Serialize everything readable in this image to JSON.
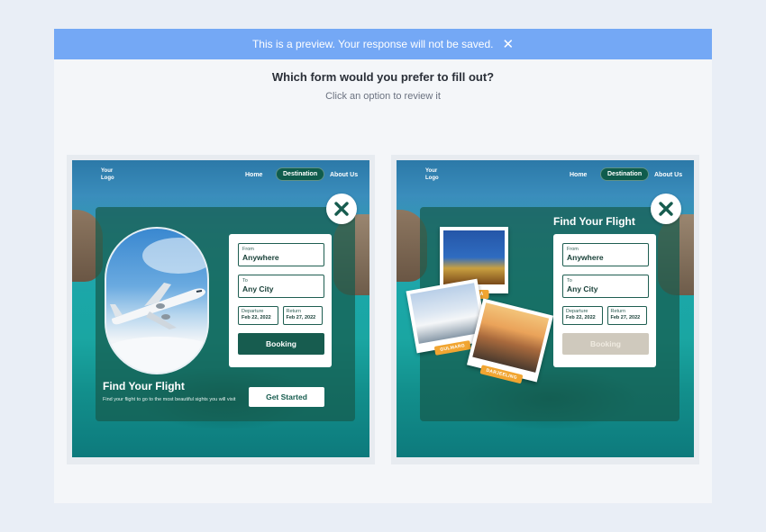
{
  "banner": {
    "text": "This is a preview. Your response will not be saved.",
    "close": "✕"
  },
  "question": "Which form would you prefer to fill out?",
  "hint": "Click an option to review it",
  "nav": {
    "logo": "Your Logo",
    "home": "Home",
    "destination": "Destination",
    "about": "About Us"
  },
  "form": {
    "from_label": "From",
    "from_value": "Anywhere",
    "to_label": "To",
    "to_value": "Any City",
    "departure_label": "Departure",
    "departure_value": "Feb 22, 2022",
    "return_label": "Return",
    "return_value": "Feb 27, 2022",
    "booking": "Booking"
  },
  "option_a": {
    "title": "Find Your Flight",
    "subtitle": "Find your flight to go to the most beautiful sights you will visit",
    "cta": "Get Started"
  },
  "option_b": {
    "title": "Find Your Flight",
    "photos": [
      "SHIMLA",
      "GULMARG",
      "DARJEELING"
    ]
  },
  "colors": {
    "accent": "#175c4f",
    "banner": "#74a8f5",
    "tag": "#f1a531"
  }
}
